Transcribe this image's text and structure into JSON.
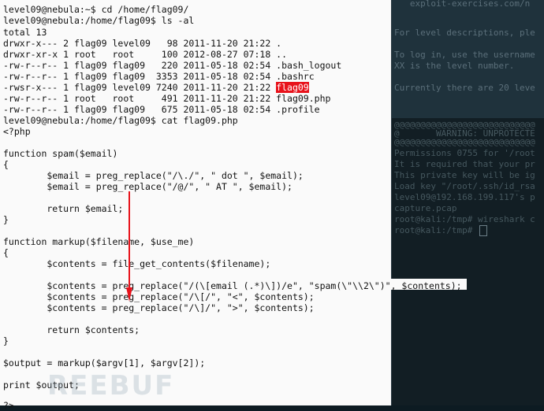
{
  "bg_terminal": {
    "top_lines": [
      "   exploit-exercises.com/n",
      "",
      "For level descriptions, ple",
      "",
      "To log in, use the username",
      "XX is the level number.",
      "",
      "Currently there are 20 leve"
    ],
    "bottom_lines": [
      "@@@@@@@@@@@@@@@@@@@@@@@@@@@",
      "@       WARNING: UNPROTECTE",
      "@@@@@@@@@@@@@@@@@@@@@@@@@@@",
      "Permissions 0755 for '/root",
      "It is required that your pr",
      "This private key will be ig",
      "Load key \"/root/.ssh/id_rsa",
      "level09@192.168.199.117's p",
      "capture.pcap",
      "root@kali:/tmp# wireshark c",
      "root@kali:/tmp# "
    ]
  },
  "terminal": {
    "lines": [
      "level09@nebula:~$ cd /home/flag09/",
      "level09@nebula:/home/flag09$ ls -al",
      "total 13",
      "drwxr-x--- 2 flag09 level09   98 2011-11-20 21:22 .",
      "drwxr-xr-x 1 root   root     100 2012-08-27 07:18 ..",
      "-rw-r--r-- 1 flag09 flag09   220 2011-05-18 02:54 .bash_logout",
      "-rw-r--r-- 1 flag09 flag09  3353 2011-05-18 02:54 .bashrc",
      "-rwsr-x--- 1 flag09 level09 7240 2011-11-20 21:22 ",
      "-rw-r--r-- 1 root   root     491 2011-11-20 21:22 flag09.php",
      "-rw-r--r-- 1 flag09 flag09   675 2011-05-18 02:54 .profile",
      "level09@nebula:/home/flag09$ cat flag09.php",
      "<?php",
      "",
      "function spam($email)",
      "{",
      "        $email = preg_replace(\"/\\./\", \" dot \", $email);",
      "        $email = preg_replace(\"/@/\", \" AT \", $email);",
      "",
      "        return $email;",
      "}",
      "",
      "function markup($filename, $use_me)",
      "{",
      "        $contents = file_get_contents($filename);",
      "",
      "        $contents = preg_replace(\"/(\\[email (.*)\\])/e\", \"spam(\\\"\\\\2\\\")\", $contents);",
      "        $contents = preg_replace(\"/\\[/\", \"<\", $contents);",
      "        $contents = preg_replace(\"/\\]/\", \">\", $contents);",
      "",
      "        return $contents;",
      "}",
      "",
      "$output = markup($argv[1], $argv[2]);",
      "",
      "print $output;",
      "",
      "?>"
    ],
    "highlighted_file": "flag09"
  },
  "watermark": "REEBUF",
  "colors": {
    "highlight": "#e8121b",
    "arrow": "#e8121b"
  }
}
